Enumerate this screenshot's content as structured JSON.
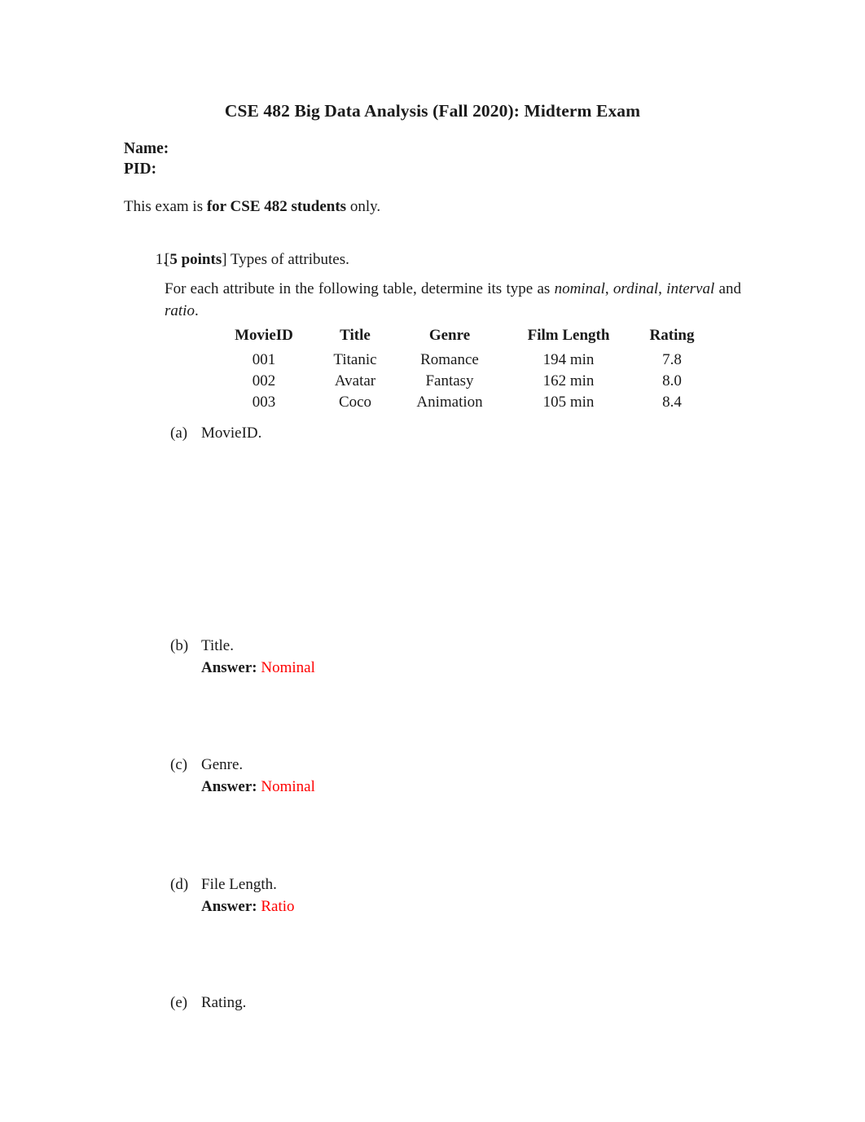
{
  "document": {
    "title": "CSE 482 Big Data Analysis (Fall 2020): Midterm Exam",
    "name_label": "Name:",
    "pid_label": "PID:",
    "audience_prefix": "This exam is ",
    "audience_bold": "for CSE 482 students",
    "audience_suffix": " only.",
    "answer_color": "#ff0000"
  },
  "question": {
    "number": "1.",
    "points_bracket_open": "[",
    "points": "5 points",
    "points_bracket_close": "]",
    "heading": " Types of attributes.",
    "body_part1": "For each attribute in the following table, determine its type as ",
    "body_italic1": "nominal",
    "body_sep1": ", ",
    "body_italic2": "ordinal",
    "body_sep2": ", ",
    "body_italic3": "interval",
    "body_sep3": " and ",
    "body_italic4": "ratio",
    "body_end": "."
  },
  "table": {
    "headers": [
      "MovieID",
      "Title",
      "Genre",
      "Film Length",
      "Rating"
    ],
    "rows": [
      [
        "001",
        "Titanic",
        "Romance",
        "194 min",
        "7.8"
      ],
      [
        "002",
        "Avatar",
        "Fantasy",
        "162 min",
        "8.0"
      ],
      [
        "003",
        "Coco",
        "Animation",
        "105 min",
        "8.4"
      ]
    ]
  },
  "subitems": [
    {
      "marker": "(a)",
      "text": "MovieID.",
      "answer_label": "",
      "answer_value": ""
    },
    {
      "marker": "(b)",
      "text": "Title.",
      "answer_label": "Answer:",
      "answer_value": "Nominal"
    },
    {
      "marker": "(c)",
      "text": "Genre.",
      "answer_label": "Answer:",
      "answer_value": "Nominal"
    },
    {
      "marker": "(d)",
      "text": "File Length.",
      "answer_label": "Answer:",
      "answer_value": "Ratio"
    },
    {
      "marker": "(e)",
      "text": "Rating.",
      "answer_label": "",
      "answer_value": ""
    }
  ]
}
